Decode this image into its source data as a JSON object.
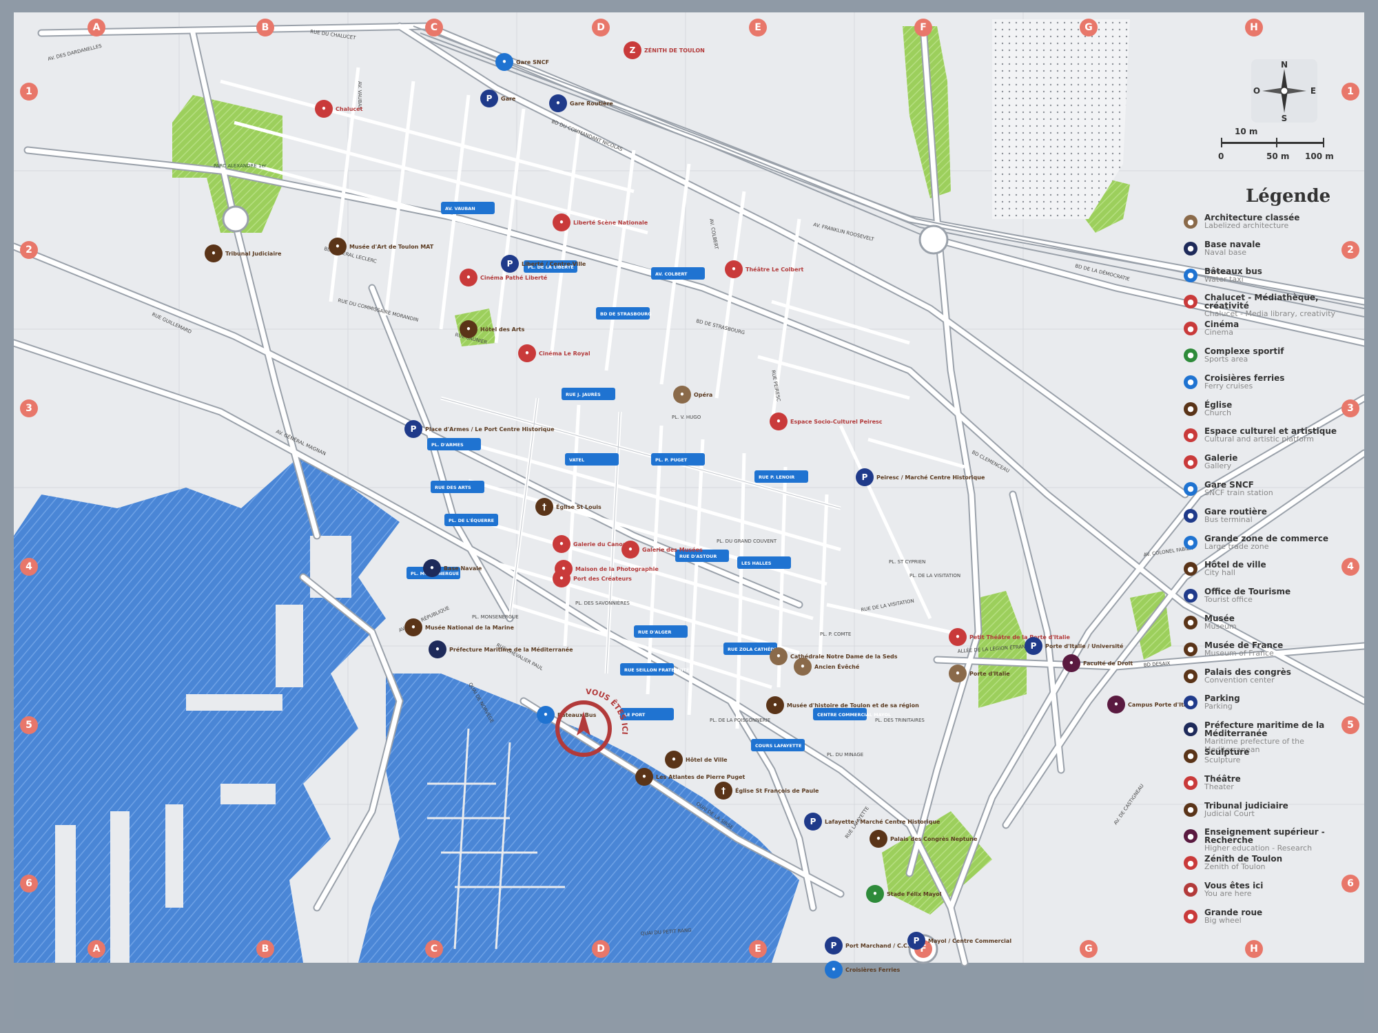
{
  "grid": {
    "columns": [
      "A",
      "B",
      "C",
      "D",
      "E",
      "F",
      "G",
      "H"
    ],
    "rows": [
      "1",
      "2",
      "3",
      "4",
      "5",
      "6"
    ]
  },
  "compass": {
    "n": "N",
    "s": "S",
    "e": "E",
    "o": "O"
  },
  "scale": {
    "top": "10 m",
    "ticks": [
      "0",
      "50 m",
      "100 m"
    ]
  },
  "legend": {
    "title": "Légende",
    "items": [
      {
        "fr": "Architecture classée",
        "en": "Labelized architecture",
        "color": "#8a6a4a",
        "icon": "architecture-icon"
      },
      {
        "fr": "Base navale",
        "en": "Naval base",
        "color": "#1e2a5a",
        "icon": "anchor-icon"
      },
      {
        "fr": "Bâteaux bus",
        "en": "Water taxi",
        "color": "#1f73d1",
        "icon": "boat-icon"
      },
      {
        "fr": "Chalucet - Médiathèque, créativité",
        "en": "Chalucet - Media library, creativity",
        "color": "#c93a3a",
        "icon": "bulb-icon"
      },
      {
        "fr": "Cinéma",
        "en": "Cinema",
        "color": "#c93a3a",
        "icon": "film-icon"
      },
      {
        "fr": "Complexe sportif",
        "en": "Sports area",
        "color": "#2e8b3a",
        "icon": "sport-icon"
      },
      {
        "fr": "Croisières ferries",
        "en": "Ferry cruises",
        "color": "#1f73d1",
        "icon": "ferry-icon"
      },
      {
        "fr": "Église",
        "en": "Church",
        "color": "#5a3418",
        "icon": "cross-icon"
      },
      {
        "fr": "Espace culturel et artistique",
        "en": "Cultural and artistic platform",
        "color": "#c93a3a",
        "icon": "culture-icon"
      },
      {
        "fr": "Galerie",
        "en": "Gallery",
        "color": "#c93a3a",
        "icon": "gallery-icon"
      },
      {
        "fr": "Gare SNCF",
        "en": "SNCF train station",
        "color": "#1f73d1",
        "icon": "train-icon"
      },
      {
        "fr": "Gare routière",
        "en": "Bus terminal",
        "color": "#1f3a8a",
        "icon": "bus-icon"
      },
      {
        "fr": "Grande zone de commerce",
        "en": "Large trade zone",
        "color": "#1f73d1",
        "icon": "shop-icon"
      },
      {
        "fr": "Hôtel de ville",
        "en": "City hall",
        "color": "#5a3418",
        "icon": "cityhall-icon"
      },
      {
        "fr": "Office de Tourisme",
        "en": "Tourist office",
        "color": "#1f3a8a",
        "icon": "tourism-icon"
      },
      {
        "fr": "Musée",
        "en": "Museum",
        "color": "#5a3418",
        "icon": "museum-icon"
      },
      {
        "fr": "Musée de France",
        "en": "Museum of France",
        "color": "#5a3418",
        "icon": "museum-france-icon"
      },
      {
        "fr": "Palais des congrès",
        "en": "Convention center",
        "color": "#5a3418",
        "icon": "congress-icon"
      },
      {
        "fr": "Parking",
        "en": "Parking",
        "color": "#1f3a8a",
        "icon": "parking-icon"
      },
      {
        "fr": "Préfecture maritime de la Méditerranée",
        "en": "Maritime prefecture of the Mediterranean",
        "color": "#1e2a5a",
        "icon": "prefecture-icon"
      },
      {
        "fr": "Sculpture",
        "en": "Sculpture",
        "color": "#5a3418",
        "icon": "sculpture-icon"
      },
      {
        "fr": "Théâtre",
        "en": "Theater",
        "color": "#c93a3a",
        "icon": "theater-icon"
      },
      {
        "fr": "Tribunal judiciaire",
        "en": "Judicial Court",
        "color": "#5a3418",
        "icon": "court-icon"
      },
      {
        "fr": "Enseignement supérieur - Recherche",
        "en": "Higher education - Research",
        "color": "#5a1a40",
        "icon": "education-icon"
      },
      {
        "fr": "Zénith de Toulon",
        "en": "Zenith of Toulon",
        "color": "#c93a3a",
        "icon": "zenith-icon"
      },
      {
        "fr": "Vous êtes ici",
        "en": "You are here",
        "color": "#b23a3a",
        "icon": "you-are-here-icon"
      },
      {
        "fr": "Grande roue",
        "en": "Big wheel",
        "color": "#c93a3a",
        "icon": "big-wheel-icon"
      }
    ]
  },
  "map": {
    "you_are_here": "VOUS ÊTES ICI",
    "pois": [
      {
        "label": "Gare SNCF",
        "color": "#1f73d1",
        "type": "train"
      },
      {
        "label": "Gare",
        "color": "#1f3a8a",
        "type": "parking"
      },
      {
        "label": "Gare Routière",
        "color": "#1f3a8a",
        "type": "bus"
      },
      {
        "label": "ZÉNITH DE TOULON",
        "color": "#c93a3a",
        "type": "zenith"
      },
      {
        "label": "Chalucet",
        "color": "#c93a3a",
        "type": "bulb"
      },
      {
        "label": "Tribunal Judiciaire",
        "color": "#5a3418",
        "type": "court"
      },
      {
        "label": "Musée d'Art de Toulon MAT",
        "color": "#5a3418",
        "type": "museum"
      },
      {
        "label": "Liberté Scène Nationale",
        "color": "#c93a3a",
        "type": "theater"
      },
      {
        "label": "Cinéma Pathé Liberté",
        "color": "#c93a3a",
        "type": "film"
      },
      {
        "label": "Liberté / Centre-Ville",
        "color": "#1f3a8a",
        "type": "parking"
      },
      {
        "label": "Théâtre Le Colbert",
        "color": "#c93a3a",
        "type": "theater"
      },
      {
        "label": "Hôtel des Arts",
        "color": "#5a3418",
        "type": "museum"
      },
      {
        "label": "Cinéma Le Royal",
        "color": "#c93a3a",
        "type": "film"
      },
      {
        "label": "Opéra",
        "color": "#8a6a4a",
        "type": "architecture"
      },
      {
        "label": "Espace Socio-Culturel Peiresc",
        "color": "#c93a3a",
        "type": "culture"
      },
      {
        "label": "Place d'Armes / Le Port Centre Historique",
        "color": "#1f3a8a",
        "type": "parking"
      },
      {
        "label": "Peiresc / Marché Centre Historique",
        "color": "#1f3a8a",
        "type": "parking"
      },
      {
        "label": "Église St Louis",
        "color": "#5a3418",
        "type": "church"
      },
      {
        "label": "Galerie du Canon",
        "color": "#c93a3a",
        "type": "gallery"
      },
      {
        "label": "Galerie des Musées",
        "color": "#c93a3a",
        "type": "gallery"
      },
      {
        "label": "Maison de la Photographie",
        "color": "#c93a3a",
        "type": "gallery"
      },
      {
        "label": "Port des Créateurs",
        "color": "#c93a3a",
        "type": "culture"
      },
      {
        "label": "Base Navale",
        "color": "#1e2a5a",
        "type": "anchor"
      },
      {
        "label": "Musée National de la Marine",
        "color": "#5a3418",
        "type": "museum"
      },
      {
        "label": "Préfecture Maritime de la Méditerranée",
        "color": "#1e2a5a",
        "type": "prefecture"
      },
      {
        "label": "Bâteaux Bus",
        "color": "#1f73d1",
        "type": "boat"
      },
      {
        "label": "Cathédrale Notre Dame de la Seds",
        "color": "#8a6a4a",
        "type": "architecture"
      },
      {
        "label": "Ancien Évêché",
        "color": "#8a6a4a",
        "type": "architecture"
      },
      {
        "label": "Musée d'histoire de Toulon et de sa région",
        "color": "#5a3418",
        "type": "museum"
      },
      {
        "label": "Hôtel de Ville",
        "color": "#5a3418",
        "type": "cityhall"
      },
      {
        "label": "Les Atlantes de Pierre Puget",
        "color": "#5a3418",
        "type": "sculpture"
      },
      {
        "label": "Église St François de Paule",
        "color": "#5a3418",
        "type": "church"
      },
      {
        "label": "Petit Théâtre de la Porte d'Italie",
        "color": "#c93a3a",
        "type": "theater"
      },
      {
        "label": "Porte d'Italie",
        "color": "#8a6a4a",
        "type": "architecture"
      },
      {
        "label": "Porte d'Italie / Université",
        "color": "#1f3a8a",
        "type": "parking"
      },
      {
        "label": "Faculté de Droit",
        "color": "#5a1a40",
        "type": "education"
      },
      {
        "label": "Campus Porte d'Italie",
        "color": "#5a1a40",
        "type": "education"
      },
      {
        "label": "Lafayette / Marché Centre Historique",
        "color": "#1f3a8a",
        "type": "parking"
      },
      {
        "label": "Palais des Congrès Neptune",
        "color": "#5a3418",
        "type": "congress"
      },
      {
        "label": "Stade Félix Mayol",
        "color": "#2e8b3a",
        "type": "sport"
      },
      {
        "label": "Port Marchand / C.C.I.",
        "color": "#1f3a8a",
        "type": "parking"
      },
      {
        "label": "Croisières Ferries",
        "color": "#1f73d1",
        "type": "ferry"
      },
      {
        "label": "Mayol / Centre Commercial",
        "color": "#1f3a8a",
        "type": "parking"
      }
    ],
    "bus_stops": [
      "AV. VAUBAN",
      "PL. DE LA LIBERTÉ",
      "AV. COLBERT",
      "BD DE STRASBOURG",
      "RUE J. JAURÈS",
      "PL. D'ARMES",
      "PL. P. PUGET",
      "RUE P. LENOIR",
      "RUE DES ARTS",
      "PL. DE L'ÉQUERRE",
      "RUE D'ASTOUR",
      "LES HALLES",
      "PL. MONSENERGUE",
      "RUE D'ALGER",
      "RUE ZOLA CATHÉDRALE",
      "RUE SEILLON FRATERNITÉ",
      "LE PORT",
      "CENTRE COMMERCIAL MAYOL",
      "COURS LAFAYETTE",
      "VATEL"
    ],
    "streets": [
      "BD DU COMMANDANT NICOLAS",
      "BD DE STRASBOURG",
      "BD GÉNÉRAL LECLERC",
      "AV. DES DARDANELLES",
      "RUE DU CHALUCET",
      "AV. VAUBAN",
      "AV. COLBERT",
      "RUE PEIRESC",
      "AV. FRANKLIN ROOSEVELT",
      "BD DE LA DÉMOCRATIE",
      "RUE CHEVALIER PAUL",
      "AV. DE LA RÉPUBLIQUE",
      "QUAI DE NORVÈGE",
      "QUAI DE LA SINSE",
      "QUAI DU PETIT RANG",
      "RUE LAFAYETTE",
      "AV. GÉNÉRAL MAGNAN",
      "RUE DU COMMISSAIRE MORANDIN",
      "RUE GUILLEMARD",
      "BD CLEMENCEAU",
      "ALLÉE DE LA LÉGION ÉTRANGÈRE",
      "RUE DE LA VISITATION",
      "AV. COLONEL FABIEN",
      "AV. DE CASTIGNEAU",
      "BD DESAIX",
      "RUE SAUNIER",
      "PARC ALEXANDRE 1er",
      "PL. V. HUGO",
      "PL. DU GRAND COUVENT",
      "PL. DES SAVONNIÈRES",
      "PL. DE LA POISSONNERIE",
      "PL. ST CYPRIEN",
      "PL. DE LA VISITATION",
      "PL. P. COMTE",
      "PL. DU MINAGE",
      "PL. MONSENERGUE",
      "PL. DES TRINITAIRES"
    ]
  }
}
